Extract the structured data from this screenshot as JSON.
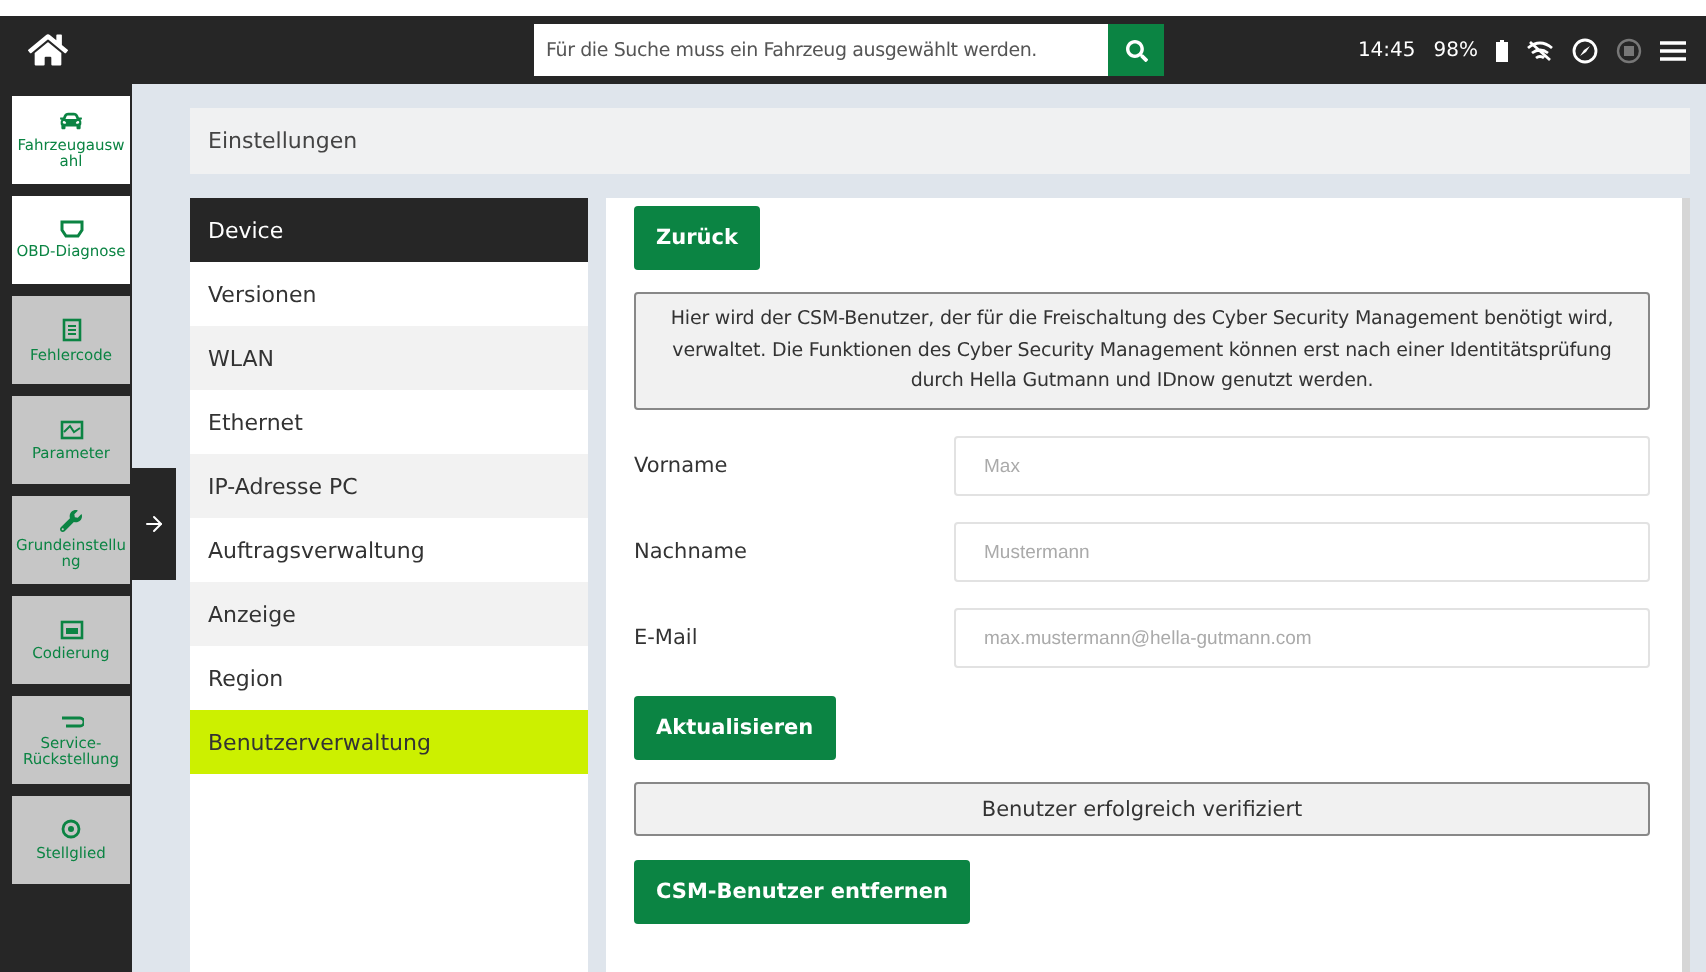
{
  "search": {
    "placeholder": "Für die Suche muss ein Fahrzeug ausgewählt werden."
  },
  "status": {
    "time": "14:45",
    "battery": "98%"
  },
  "nav": [
    {
      "label": "Fahrzeugauswahl",
      "enabled": true
    },
    {
      "label": "OBD-Diagnose",
      "enabled": true
    },
    {
      "label": "Fehlercode",
      "enabled": false
    },
    {
      "label": "Parameter",
      "enabled": false
    },
    {
      "label": "Grundeinstellung",
      "enabled": false
    },
    {
      "label": "Codierung",
      "enabled": false
    },
    {
      "label": "Service-Rückstellung",
      "enabled": false
    },
    {
      "label": "Stellglied",
      "enabled": false
    }
  ],
  "breadcrumb": "Einstellungen",
  "menu": [
    {
      "kind": "header",
      "label": "Device"
    },
    {
      "kind": "item",
      "label": "Versionen",
      "selected": false
    },
    {
      "kind": "item",
      "label": "WLAN",
      "selected": false
    },
    {
      "kind": "item",
      "label": "Ethernet",
      "selected": false
    },
    {
      "kind": "item",
      "label": "IP-Adresse PC",
      "selected": false
    },
    {
      "kind": "item",
      "label": "Auftragsverwaltung",
      "selected": false
    },
    {
      "kind": "item",
      "label": "Anzeige",
      "selected": false
    },
    {
      "kind": "item",
      "label": "Region",
      "selected": false
    },
    {
      "kind": "item",
      "label": "Benutzerverwaltung",
      "selected": true
    }
  ],
  "back_button": "Zurück",
  "info": "Hier wird der CSM-Benutzer, der für die Freischaltung des Cyber Security Management benötigt wird, verwaltet. Die Funktionen des Cyber Security Management können erst nach einer Identitätsprüfung durch Hella Gutmann und IDnow genutzt werden.",
  "fields": [
    {
      "label": "Vorname",
      "placeholder": "Max"
    },
    {
      "label": "Nachname",
      "placeholder": "Mustermann"
    },
    {
      "label": "E-Mail",
      "placeholder": "max.mustermann@hella-gutmann.com"
    }
  ],
  "update_button": "Aktualisieren",
  "status_message": "Benutzer erfolgreich verifiziert",
  "remove_button": "CSM-Benutzer entfernen"
}
